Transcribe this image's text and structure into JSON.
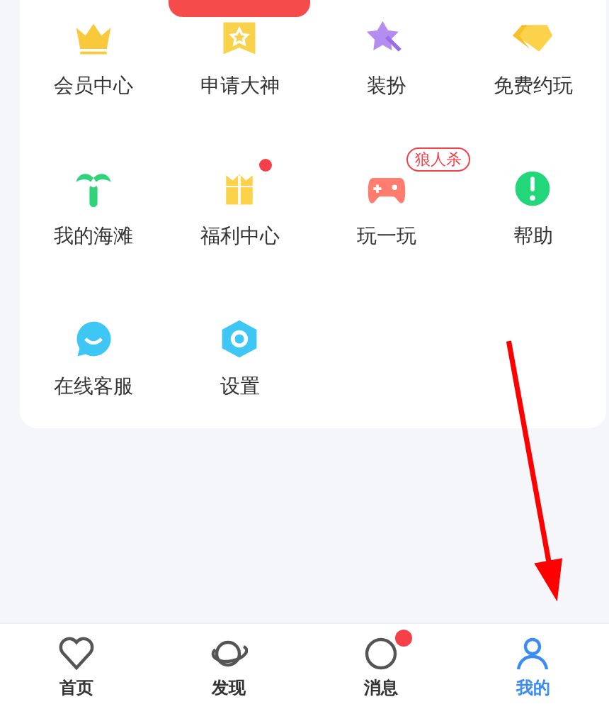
{
  "menu": [
    {
      "label": "会员中心",
      "kind": "crown"
    },
    {
      "label": "申请大神",
      "kind": "badge",
      "bubble": true
    },
    {
      "label": "装扮",
      "kind": "wand"
    },
    {
      "label": "免费约玩",
      "kind": "gem"
    },
    {
      "label": "我的海滩",
      "kind": "palm"
    },
    {
      "label": "福利中心",
      "kind": "gift",
      "dot": true
    },
    {
      "label": "玩一玩",
      "kind": "game",
      "tag": "狼人杀"
    },
    {
      "label": "帮助",
      "kind": "help"
    },
    {
      "label": "在线客服",
      "kind": "chat"
    },
    {
      "label": "设置",
      "kind": "settings"
    }
  ],
  "tabs": [
    {
      "label": "首页",
      "kind": "home",
      "selected": false
    },
    {
      "label": "发现",
      "kind": "discover",
      "selected": false
    },
    {
      "label": "消息",
      "kind": "messages",
      "selected": false,
      "badge": true
    },
    {
      "label": "我的",
      "kind": "me",
      "selected": true
    }
  ]
}
